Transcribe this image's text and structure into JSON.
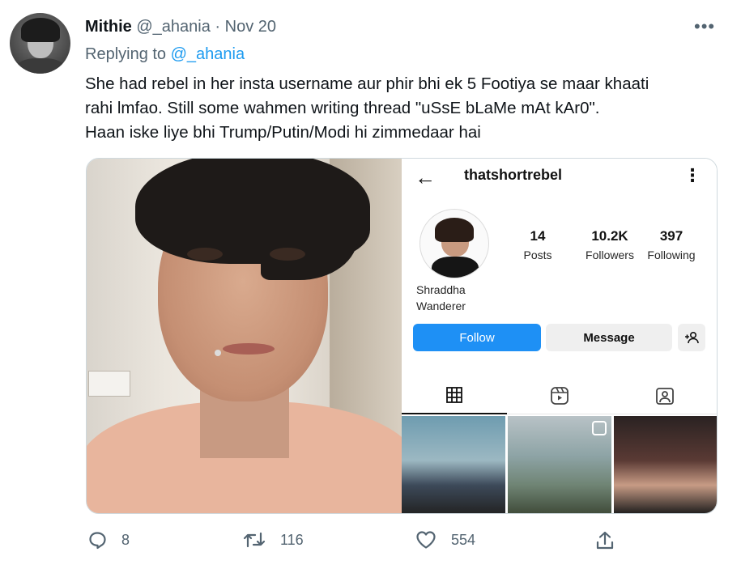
{
  "tweet": {
    "author_name": "Mithie",
    "author_handle": "@_ahania",
    "separator": "·",
    "date": "Nov 20",
    "more_icon": "more-horizontal-icon",
    "replying_prefix": "Replying to",
    "replying_handle": "@_ahania",
    "text_line1": "She had rebel in her insta username aur phir bhi ek 5 Footiya se maar khaati",
    "text_line2": "rahi lmfao. Still some wahmen writing thread \"uSsE bLaMe mAt kAr0\".",
    "text_line3": "Haan iske liye bhi Trump/Putin/Modi hi zimmedaar hai"
  },
  "instagram": {
    "username": "thatshortrebel",
    "stats": [
      {
        "value": "14",
        "label": "Posts"
      },
      {
        "value": "10.2K",
        "label": "Followers"
      },
      {
        "value": "397",
        "label": "Following"
      }
    ],
    "bio_line1": "Shraddha",
    "bio_line2": "Wanderer",
    "follow_label": "Follow",
    "message_label": "Message",
    "follow_color": "#1e90f5"
  },
  "actions": {
    "reply_count": "8",
    "retweet_count": "116",
    "like_count": "554"
  },
  "colors": {
    "link": "#1d9bf0",
    "muted": "#536471",
    "text": "#0f1419"
  }
}
